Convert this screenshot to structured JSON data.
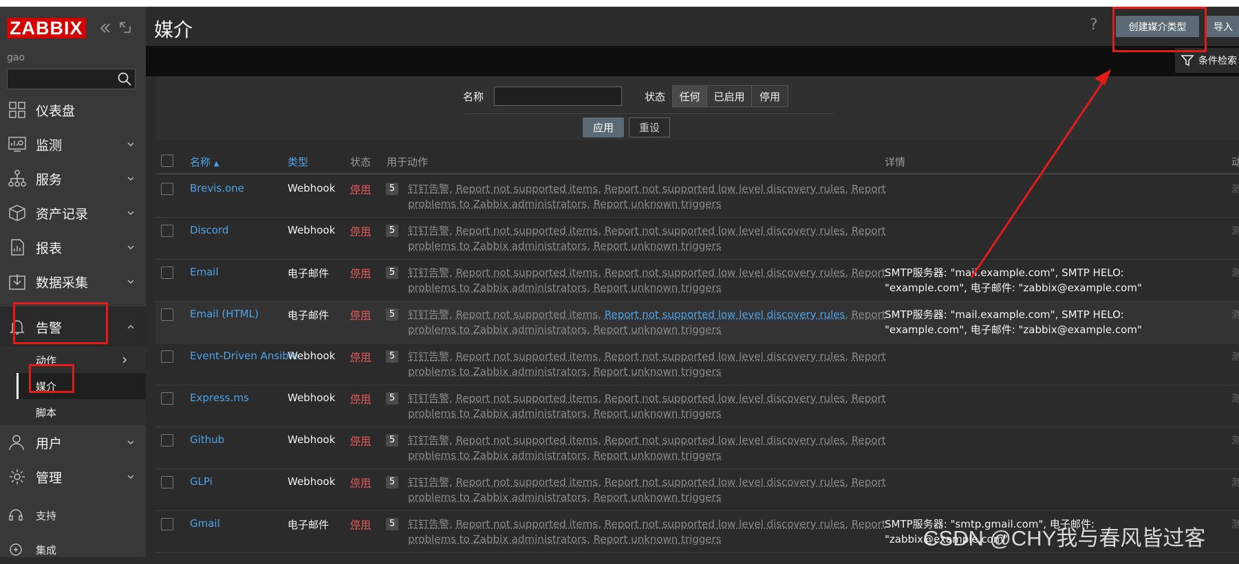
{
  "app": {
    "logo": "ZABBIX",
    "user": "gao",
    "page_title": "媒介"
  },
  "sidebar": {
    "items": [
      {
        "label": "仪表盘",
        "icon": "dashboard-icon"
      },
      {
        "label": "监测",
        "icon": "monitoring-icon"
      },
      {
        "label": "服务",
        "icon": "services-icon"
      },
      {
        "label": "资产记录",
        "icon": "inventory-icon"
      },
      {
        "label": "报表",
        "icon": "reports-icon"
      },
      {
        "label": "数据采集",
        "icon": "data-collection-icon"
      },
      {
        "label": "告警",
        "icon": "bell-icon"
      }
    ],
    "alerts_sub": [
      {
        "label": "动作"
      },
      {
        "label": "媒介"
      },
      {
        "label": "脚本"
      }
    ],
    "lower_items": [
      {
        "label": "用户",
        "icon": "user-icon"
      },
      {
        "label": "管理",
        "icon": "gear-icon"
      }
    ],
    "bottom": [
      {
        "label": "支持",
        "icon": "headset-icon"
      },
      {
        "label": "集成",
        "icon": "integrations-icon"
      }
    ]
  },
  "header": {
    "help": "?",
    "create_label": "创建媒介类型",
    "import_label": "导入",
    "filter_label": "条件检索"
  },
  "filter": {
    "name_label": "名称",
    "name_value": "",
    "status_label": "状态",
    "status_options": [
      "任何",
      "已启用",
      "停用"
    ],
    "status_selected": "任何",
    "apply_label": "应用",
    "reset_label": "重设"
  },
  "table": {
    "columns": {
      "name": "名称",
      "sort_arrow": "▲",
      "type": "类型",
      "status": "状态",
      "used_in": "用于动作",
      "details": "详情",
      "actions": "动作"
    },
    "actions_list": [
      "钉钉告警",
      "Report not supported items",
      "Report not supported low level discovery rules",
      "Report problems to Zabbix administrators",
      "Report unknown triggers"
    ],
    "rows": [
      {
        "name": "Brevis.one",
        "type": "Webhook",
        "status": "停用",
        "count": "5",
        "details": "",
        "test": "测试"
      },
      {
        "name": "Discord",
        "type": "Webhook",
        "status": "停用",
        "count": "5",
        "details": "",
        "test": "测试"
      },
      {
        "name": "Email",
        "type": "电子邮件",
        "status": "停用",
        "count": "5",
        "details": "SMTP服务器: \"mail.example.com\", SMTP HELO: \"example.com\", 电子邮件: \"zabbix@example.com\"",
        "test": "测试"
      },
      {
        "name": "Email (HTML)",
        "type": "电子邮件",
        "status": "停用",
        "count": "5",
        "details": "SMTP服务器: \"mail.example.com\", SMTP HELO: \"example.com\", 电子邮件: \"zabbix@example.com\"",
        "test": "测试"
      },
      {
        "name": "Event-Driven Ansible",
        "type": "Webhook",
        "status": "停用",
        "count": "5",
        "details": "",
        "test": "测试"
      },
      {
        "name": "Express.ms",
        "type": "Webhook",
        "status": "停用",
        "count": "5",
        "details": "",
        "test": "测试"
      },
      {
        "name": "Github",
        "type": "Webhook",
        "status": "停用",
        "count": "5",
        "details": "",
        "test": "测试"
      },
      {
        "name": "GLPi",
        "type": "Webhook",
        "status": "停用",
        "count": "5",
        "details": "",
        "test": "测试"
      },
      {
        "name": "Gmail",
        "type": "电子邮件",
        "status": "停用",
        "count": "5",
        "details": "SMTP服务器: \"smtp.gmail.com\", 电子邮件: \"zabbix@example.com\"",
        "test": "测试"
      }
    ]
  },
  "watermark": "CSDN @CHY我与春风皆过客",
  "colors": {
    "annotation": "#e31b1b",
    "link": "#4ea3e8",
    "disabled": "#e45959",
    "button": "#5b6a75"
  }
}
